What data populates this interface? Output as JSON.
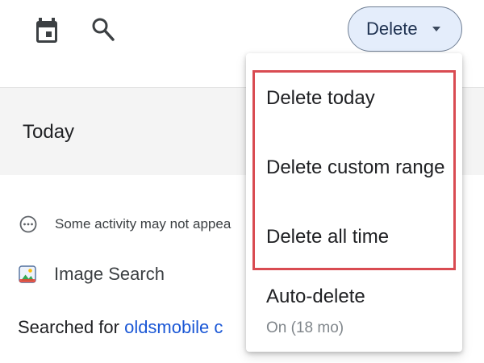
{
  "toolbar": {
    "calendar_icon": "calendar-icon",
    "search_icon": "search-icon",
    "delete_button_label": "Delete",
    "delete_button_bg": "#e4edfb"
  },
  "section": {
    "title": "Today"
  },
  "activity_notice": {
    "icon": "more-horizontal-circle-icon",
    "text": "Some activity may not appea"
  },
  "image_search": {
    "icon": "image-icon",
    "label": "Image Search"
  },
  "searched": {
    "prefix": "Searched for ",
    "query": "oldsmobile c"
  },
  "delete_menu": {
    "items": [
      {
        "label": "Delete today"
      },
      {
        "label": "Delete custom range"
      },
      {
        "label": "Delete all time"
      },
      {
        "label": "Auto-delete",
        "sublabel": "On (18 mo)"
      }
    ],
    "highlight_color": "#d94b52"
  },
  "colors": {
    "link": "#1a57d6",
    "band": "#f4f4f4"
  }
}
